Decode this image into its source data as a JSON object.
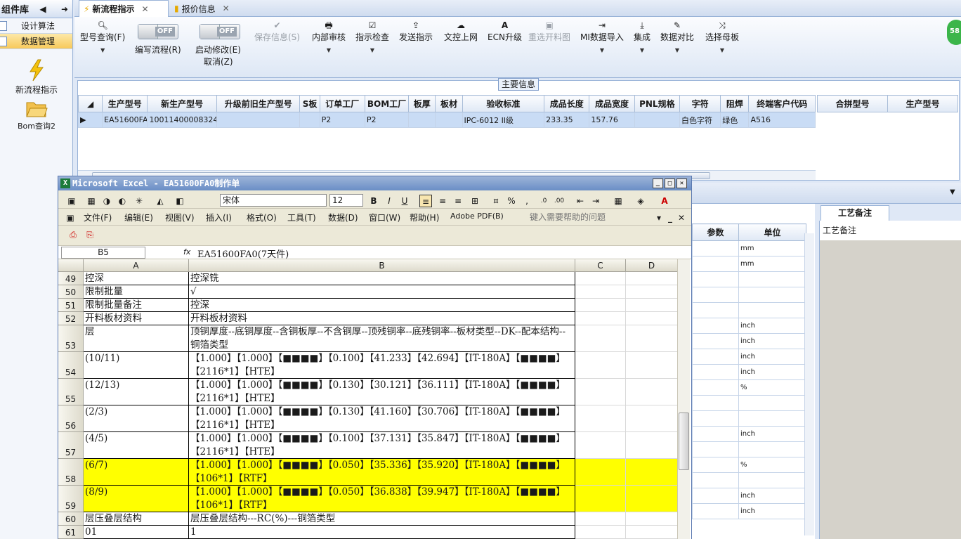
{
  "left_panel": {
    "title": "组件库",
    "items": [
      {
        "label": "设计算法"
      },
      {
        "label": "数据管理"
      }
    ],
    "big_items": [
      {
        "label": "新流程指示"
      },
      {
        "label": "Bom查询2"
      }
    ]
  },
  "tabs": [
    {
      "label": "新流程指示"
    },
    {
      "label": "报价信息"
    }
  ],
  "toolbar": {
    "buttons": [
      {
        "label": "型号查询(F)"
      },
      {
        "label": "编写流程(R)"
      },
      {
        "label": "启动修改(E)"
      },
      {
        "label": "取消(Z)"
      },
      {
        "label": "保存信息(S)"
      },
      {
        "label": "内部审核"
      },
      {
        "label": "指示检查"
      },
      {
        "label": "发送指示"
      },
      {
        "label": "文控上网"
      },
      {
        "label": "ECN升级"
      },
      {
        "label": "重选开料图"
      },
      {
        "label": "MI数据导入"
      },
      {
        "label": "集成"
      },
      {
        "label": "数据对比"
      },
      {
        "label": "选择母板"
      }
    ],
    "toggle_label": "OFF",
    "badge": "58"
  },
  "main_info": {
    "title": "主要信息",
    "columns": [
      "生产型号",
      "新生产型号",
      "升级前旧生产型号",
      "S板",
      "订单工厂",
      "BOM工厂",
      "板厚",
      "板材",
      "验收标准",
      "成品长度",
      "成品宽度",
      "PNL规格",
      "字符",
      "阻焊",
      "终端客户代码"
    ],
    "row": [
      "EA51600FA0",
      "10011400008324",
      "",
      "",
      "P2",
      "P2",
      "",
      "",
      "IPC-6012 II级",
      "233.35",
      "157.76",
      "",
      "白色字符",
      "绿色",
      "A516"
    ],
    "side_columns": [
      "合拼型号",
      "生产型号"
    ]
  },
  "param_grid": {
    "columns": [
      "参数",
      "单位"
    ],
    "units": [
      "mm",
      "mm",
      "",
      "",
      "",
      "inch",
      "inch",
      "inch",
      "inch",
      "%",
      "",
      "",
      "inch",
      "",
      "%",
      "",
      "inch",
      "inch"
    ]
  },
  "memo": {
    "tab": "工艺备注",
    "header": "工艺备注"
  },
  "excel": {
    "title": "Microsoft Excel - EA51600FA0制作单",
    "font": "宋体",
    "font_size": "12",
    "menus": [
      "文件(F)",
      "编辑(E)",
      "视图(V)",
      "插入(I)",
      "格式(O)",
      "工具(T)",
      "数据(D)",
      "窗口(W)",
      "帮助(H)",
      "Adobe PDF(B)"
    ],
    "help_placeholder": "键入需要帮助的问题",
    "name_box": "B5",
    "formula": "EA51600FA0(7天件)",
    "col_headers": [
      "A",
      "B",
      "C",
      "D"
    ],
    "rows": [
      {
        "num": "49",
        "a": "控深",
        "b": "控深铣"
      },
      {
        "num": "50",
        "a": "限制批量",
        "b": "√"
      },
      {
        "num": "51",
        "a": "限制批量备注",
        "b": "控深"
      },
      {
        "num": "52",
        "a": "开料板材资料",
        "b": "开料板材资料"
      },
      {
        "num": "53",
        "a": "层",
        "b": "顶铜厚度--底铜厚度--含铜板厚--不含铜厚--顶残铜率--底残铜率--板材类型--DK--配本结构--铜箔类型"
      },
      {
        "num": "54",
        "a": "(10/11)",
        "b": "【1.000】【1.000】【■■■■】【0.100】【41.233】【42.694】【IT-180A】【■■■■】【2116*1】【HTE】"
      },
      {
        "num": "55",
        "a": "(12/13)",
        "b": "【1.000】【1.000】【■■■■】【0.130】【30.121】【36.111】【IT-180A】【■■■■】【2116*1】【HTE】"
      },
      {
        "num": "56",
        "a": "(2/3)",
        "b": "【1.000】【1.000】【■■■■】【0.130】【41.160】【30.706】【IT-180A】【■■■■】【2116*1】【HTE】"
      },
      {
        "num": "57",
        "a": "(4/5)",
        "b": "【1.000】【1.000】【■■■■】【0.100】【37.131】【35.847】【IT-180A】【■■■■】【2116*1】【HTE】"
      },
      {
        "num": "58",
        "a": "(6/7)",
        "b": "【1.000】【1.000】【■■■■】【0.050】【35.336】【35.920】【IT-180A】【■■■■】【106*1】【RTF】"
      },
      {
        "num": "59",
        "a": "(8/9)",
        "b": "【1.000】【1.000】【■■■■】【0.050】【36.838】【39.947】【IT-180A】【■■■■】【106*1】【RTF】"
      },
      {
        "num": "60",
        "a": "层压叠层结构",
        "b": "层压叠层结构---RC(%)---铜箔类型"
      },
      {
        "num": "61",
        "a": "01",
        "b": "1"
      }
    ]
  }
}
